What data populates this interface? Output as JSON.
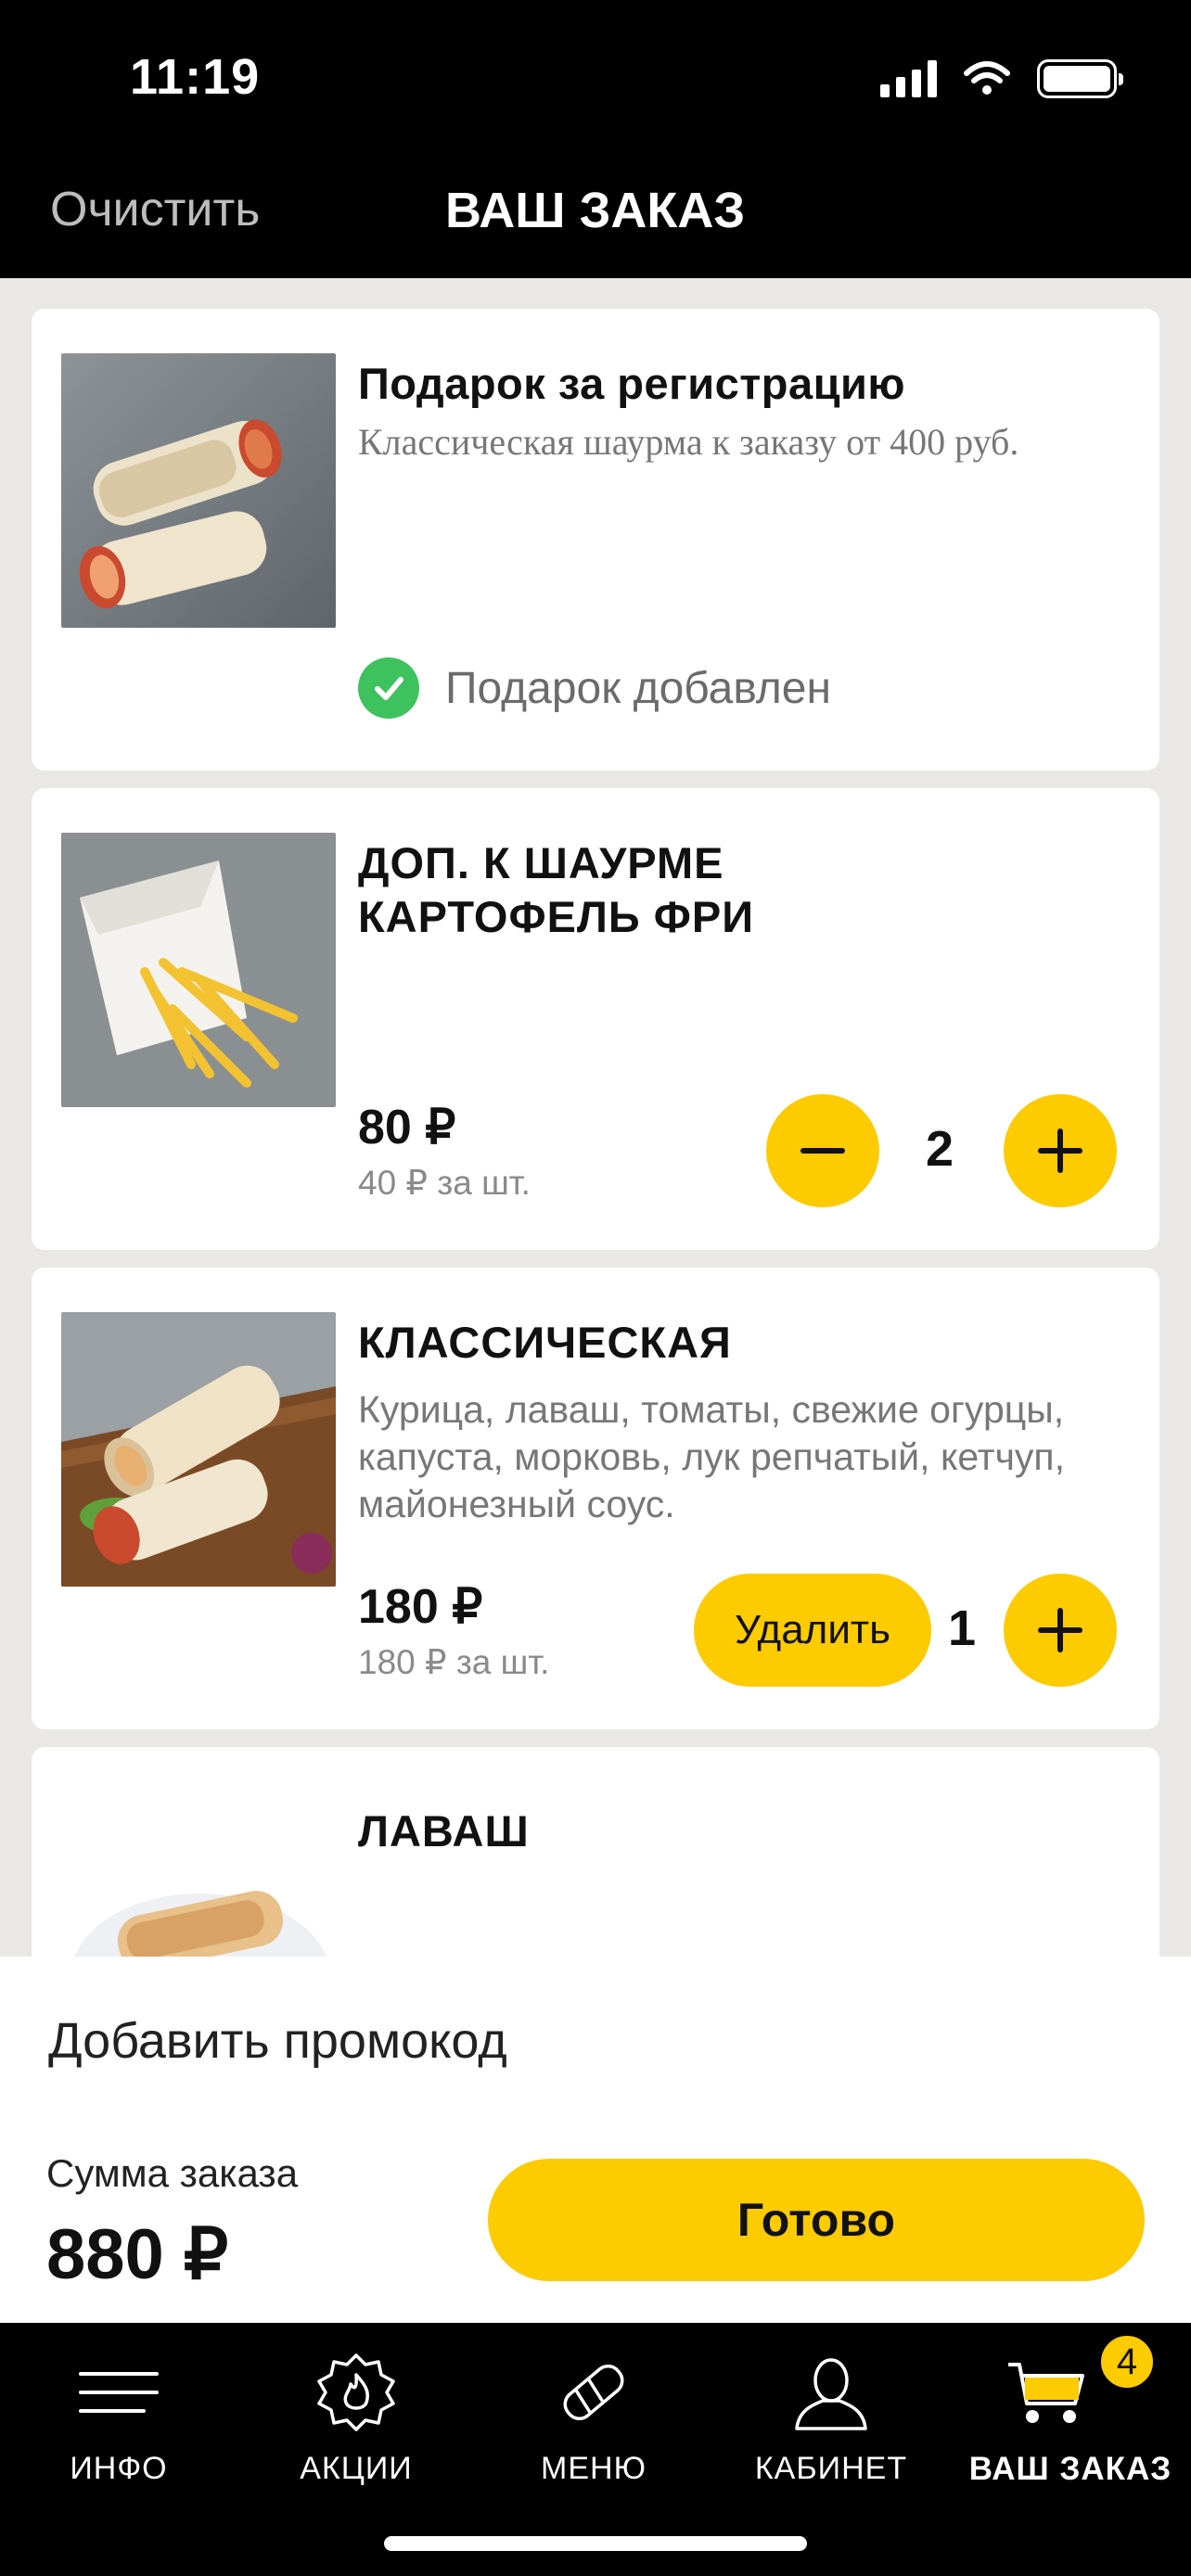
{
  "status_bar": {
    "time": "11:19"
  },
  "header": {
    "clear_label": "Очистить",
    "title": "ВАШ ЗАКАЗ"
  },
  "items": [
    {
      "name": "Подарок за регистрацию",
      "description": "Классическая шаурма к заказу от 400 руб.",
      "gift_status": "Подарок добавлен"
    },
    {
      "name_line1": "ДОП. К ШАУРМЕ",
      "name_line2": "КАРТОФЕЛЬ ФРИ",
      "price": "80 ₽",
      "unit_price": "40 ₽ за шт.",
      "quantity": "2"
    },
    {
      "name": "КЛАССИЧЕСКАЯ",
      "description_line1": "Курица, лаваш, томаты, свежие огурцы,",
      "description_line2": "капуста, морковь, лук репчатый, кетчуп,",
      "description_line3": "майонезный соус.",
      "price": "180 ₽",
      "unit_price": "180 ₽ за шт.",
      "delete_label": "Удалить",
      "quantity": "1"
    },
    {
      "name": "ЛАВАШ"
    }
  ],
  "footer": {
    "promo_label": "Добавить промокод",
    "sum_label": "Сумма заказа",
    "sum_value": "880 ₽",
    "ready_label": "Готово"
  },
  "tabbar": {
    "tabs": [
      {
        "label": "ИНФО",
        "icon": "menu-lines-icon"
      },
      {
        "label": "АКЦИИ",
        "icon": "flame-badge-icon"
      },
      {
        "label": "МЕНЮ",
        "icon": "shawarma-icon"
      },
      {
        "label": "КАБИНЕТ",
        "icon": "user-icon"
      },
      {
        "label": "ВАШ ЗАКАЗ",
        "icon": "cart-icon",
        "active": true
      }
    ],
    "cart_badge": "4"
  },
  "colors": {
    "accent": "#fccb00",
    "success": "#3ec25e",
    "bar": "#000000"
  }
}
